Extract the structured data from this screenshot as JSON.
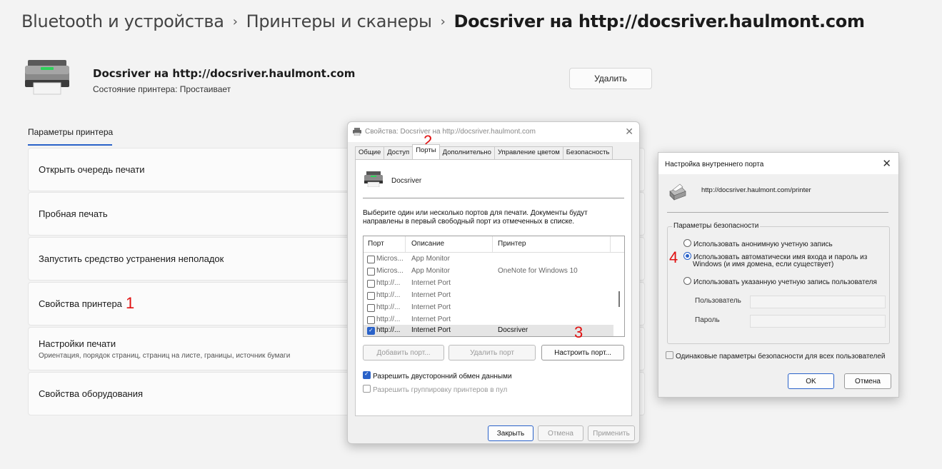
{
  "breadcrumb": {
    "part1": "Bluetooth и устройства",
    "part2": "Принтеры и сканеры",
    "current": "Docsriver на http://docsriver.haulmont.com",
    "separator": "›"
  },
  "header": {
    "printer_name": "Docsriver на http://docsriver.haulmont.com",
    "status": "Состояние принтера:  Простаивает",
    "delete_label": "Удалить"
  },
  "section_tab": "Параметры принтера",
  "cards": {
    "queue": "Открыть очередь печати",
    "test": "Пробная печать",
    "troubleshoot": "Запустить средство устранения неполадок",
    "props": "Свойства принтера",
    "print_settings": "Настройки печати",
    "print_settings_sub": "Ориентация, порядок страниц, страниц на листе, границы, источник бумаги",
    "hardware": "Свойства оборудования"
  },
  "annotations": {
    "n1": "1",
    "n2": "2",
    "n3": "3",
    "n4": "4",
    "color": "#e01010"
  },
  "props_dialog": {
    "title": "Свойства: Docsriver на http://docsriver.haulmont.com",
    "tabs": [
      "Общие",
      "Доступ",
      "Порты",
      "Дополнительно",
      "Управление цветом",
      "Безопасность"
    ],
    "active_tab": "Порты",
    "printer_name": "Docsriver",
    "instructions": "Выберите один или несколько портов для печати. Документы будут направлены в первый свободный порт из отмеченных в списке.",
    "columns": {
      "port": "Порт",
      "desc": "Описание",
      "printer": "Принтер"
    },
    "rows": [
      {
        "port": "Micros...",
        "desc": "App Monitor",
        "printer": "",
        "checked": false
      },
      {
        "port": "Micros...",
        "desc": "App Monitor",
        "printer": "OneNote for Windows 10",
        "checked": false
      },
      {
        "port": "http://...",
        "desc": "Internet Port",
        "printer": "",
        "checked": false
      },
      {
        "port": "http://...",
        "desc": "Internet Port",
        "printer": "",
        "checked": false
      },
      {
        "port": "http://...",
        "desc": "Internet Port",
        "printer": "",
        "checked": false
      },
      {
        "port": "http://...",
        "desc": "Internet Port",
        "printer": "",
        "checked": false
      },
      {
        "port": "http://...",
        "desc": "Internet Port",
        "printer": "Docsriver",
        "checked": true
      }
    ],
    "add_port": "Добавить порт...",
    "delete_port": "Удалить порт",
    "configure_port": "Настроить порт...",
    "bidi": "Разрешить двусторонний обмен данными",
    "pool": "Разрешить группировку принтеров в пул",
    "close": "Закрыть",
    "cancel": "Отмена",
    "apply": "Применить"
  },
  "port_dialog": {
    "title": "Настройка внутреннего порта",
    "url": "http://docsriver.haulmont.com/printer",
    "group_title": "Параметры безопасности",
    "opt_anon": "Использовать анонимную учетную запись",
    "opt_auto_line1": "Использовать автоматически имя входа и пароль из",
    "opt_auto_line2": "Windows (и имя домена, если существует)",
    "opt_specified": "Использовать указанную учетную запись пользователя",
    "user_label": "Пользователь",
    "password_label": "Пароль",
    "same_for_all": "Одинаковые параметры безопасности для всех пользователей",
    "ok": "OK",
    "cancel": "Отмена"
  }
}
